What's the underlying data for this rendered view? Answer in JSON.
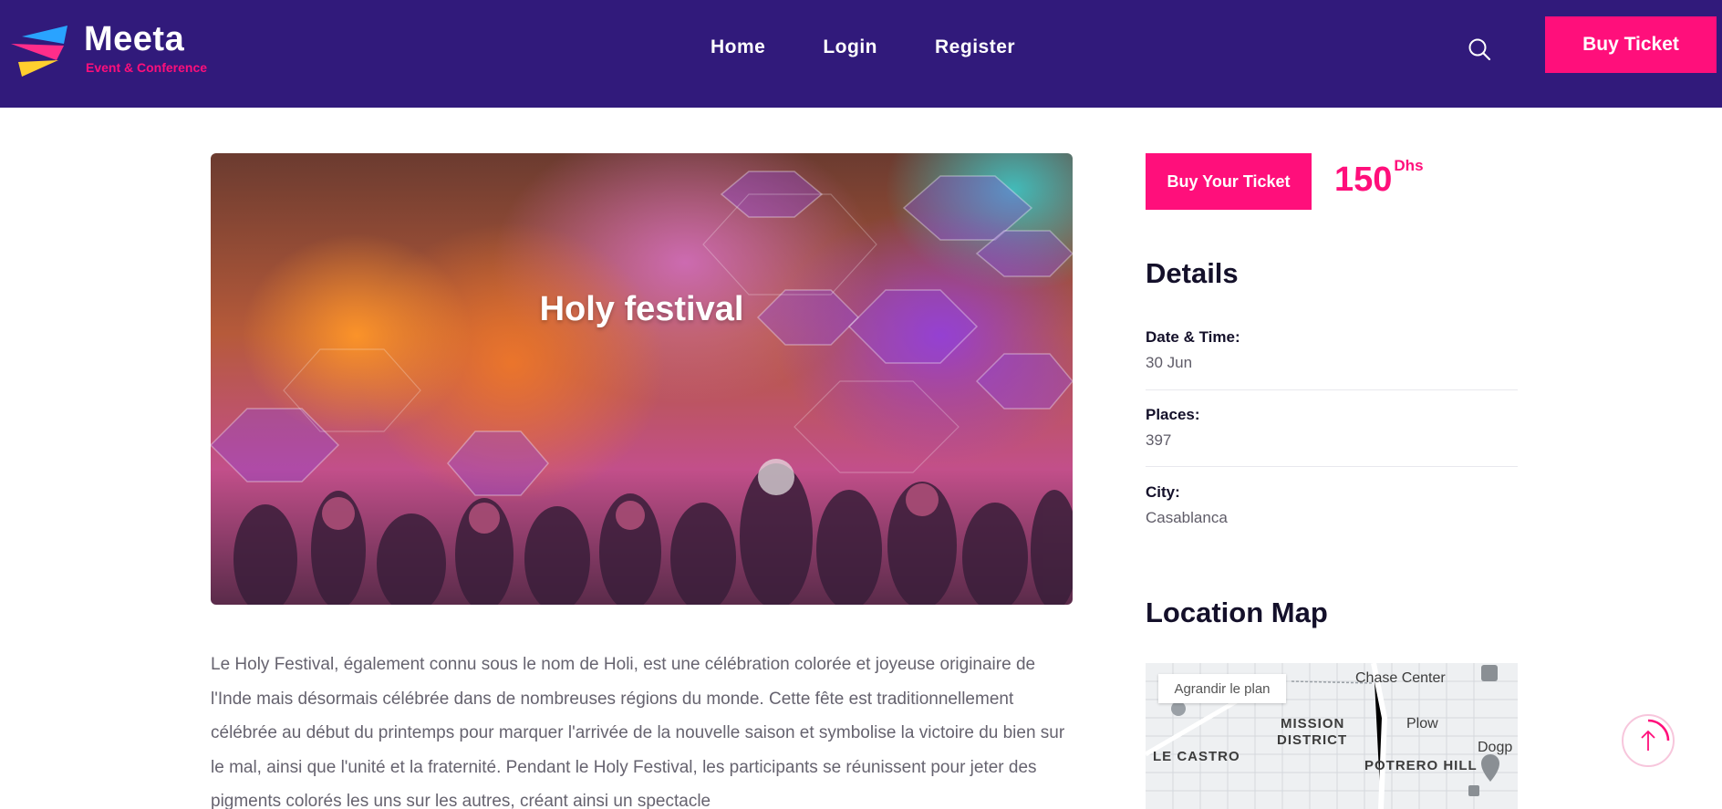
{
  "header": {
    "brand": "Meeta",
    "tagline": "Event & Conference",
    "nav": [
      "Home",
      "Login",
      "Register"
    ],
    "buy_button": "Buy Ticket"
  },
  "hero": {
    "title": "Holy festival"
  },
  "description": "Le Holy Festival, également connu sous le nom de Holi, est une célébration colorée et joyeuse originaire de l'Inde mais désormais célébrée dans de nombreuses régions du monde. Cette fête est traditionnellement célébrée au début du printemps pour marquer l'arrivée de la nouvelle saison et symbolise la victoire du bien sur le mal, ainsi que l'unité et la fraternité. Pendant le Holy Festival, les participants se réunissent pour jeter des pigments colorés les uns sur les autres, créant ainsi un spectacle",
  "sidebar": {
    "buy_button": "Buy Your Ticket",
    "price": "150",
    "currency": "Dhs",
    "details_heading": "Details",
    "details": [
      {
        "label": "Date & Time:",
        "value": "30 Jun"
      },
      {
        "label": "Places:",
        "value": "397"
      },
      {
        "label": "City:",
        "value": "Casablanca"
      }
    ],
    "map_heading": "Location Map",
    "map": {
      "enlarge_button": "Agrandir le plan",
      "labels": [
        "Chase Center",
        "MISSION",
        "DISTRICT",
        "LE CASTRO",
        "POTRERO HILL",
        "Plow",
        "Dogp"
      ]
    }
  },
  "colors": {
    "header_bg": "#311a7b",
    "accent": "#ff0f7b"
  }
}
